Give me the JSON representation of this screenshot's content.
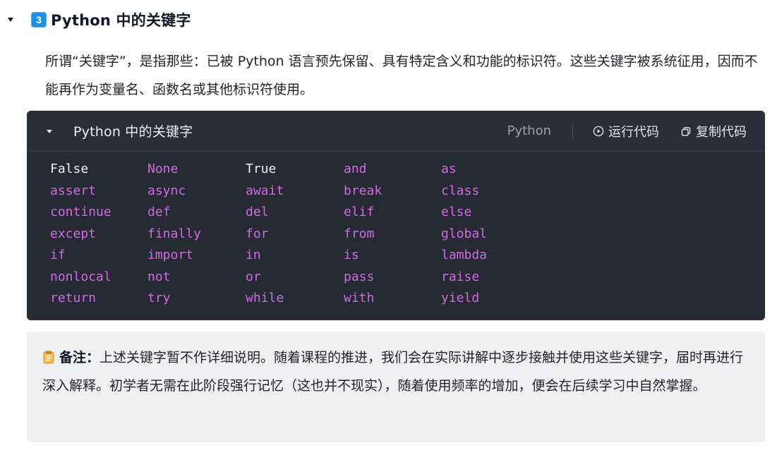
{
  "section": {
    "number": "3",
    "title": "Python 中的关键字"
  },
  "intro": {
    "text": "所谓“关键字”，是指那些：已被 Python 语言预先保留、具有特定含义和功能的标识符。这些关键字被系统征用，因而不能再作为变量名、函数名或其他标识符使用。"
  },
  "code_block": {
    "title": "Python 中的关键字",
    "language": "Python",
    "run_label": "运行代码",
    "copy_label": "复制代码",
    "rows": [
      [
        "False",
        "None",
        "True",
        "and",
        "as"
      ],
      [
        "assert",
        "async",
        "await",
        "break",
        "class"
      ],
      [
        "continue",
        "def",
        "del",
        "elif",
        "else"
      ],
      [
        "except",
        "finally",
        "for",
        "from",
        "global"
      ],
      [
        "if",
        "import",
        "in",
        "is",
        "lambda"
      ],
      [
        "nonlocal",
        "not",
        "or",
        "pass",
        "raise"
      ],
      [
        "return",
        "try",
        "while",
        "with",
        "yield"
      ]
    ],
    "const_words": [
      "False",
      "True"
    ]
  },
  "note": {
    "label": "备注：",
    "text": "上述关键字暂不作详细说明。随着课程的推进，我们会在实际讲解中逐步接触并使用这些关键字，届时再进行深入解释。初学者无需在此阶段强行记忆（这也并不现实），随着使用频率的增加，便会在后续学习中自然掌握。"
  },
  "colors": {
    "badge": "#1e8fe6",
    "code_bg": "#262a33",
    "keyword": "#d06be6",
    "constant": "#f0f0f0",
    "note_bg": "#eef0f1"
  },
  "icons": {
    "section_caret": "caret-down-icon",
    "code_caret": "caret-down-icon",
    "run": "play-circle-icon",
    "copy": "copy-icon",
    "note": "clipboard-note-icon"
  }
}
